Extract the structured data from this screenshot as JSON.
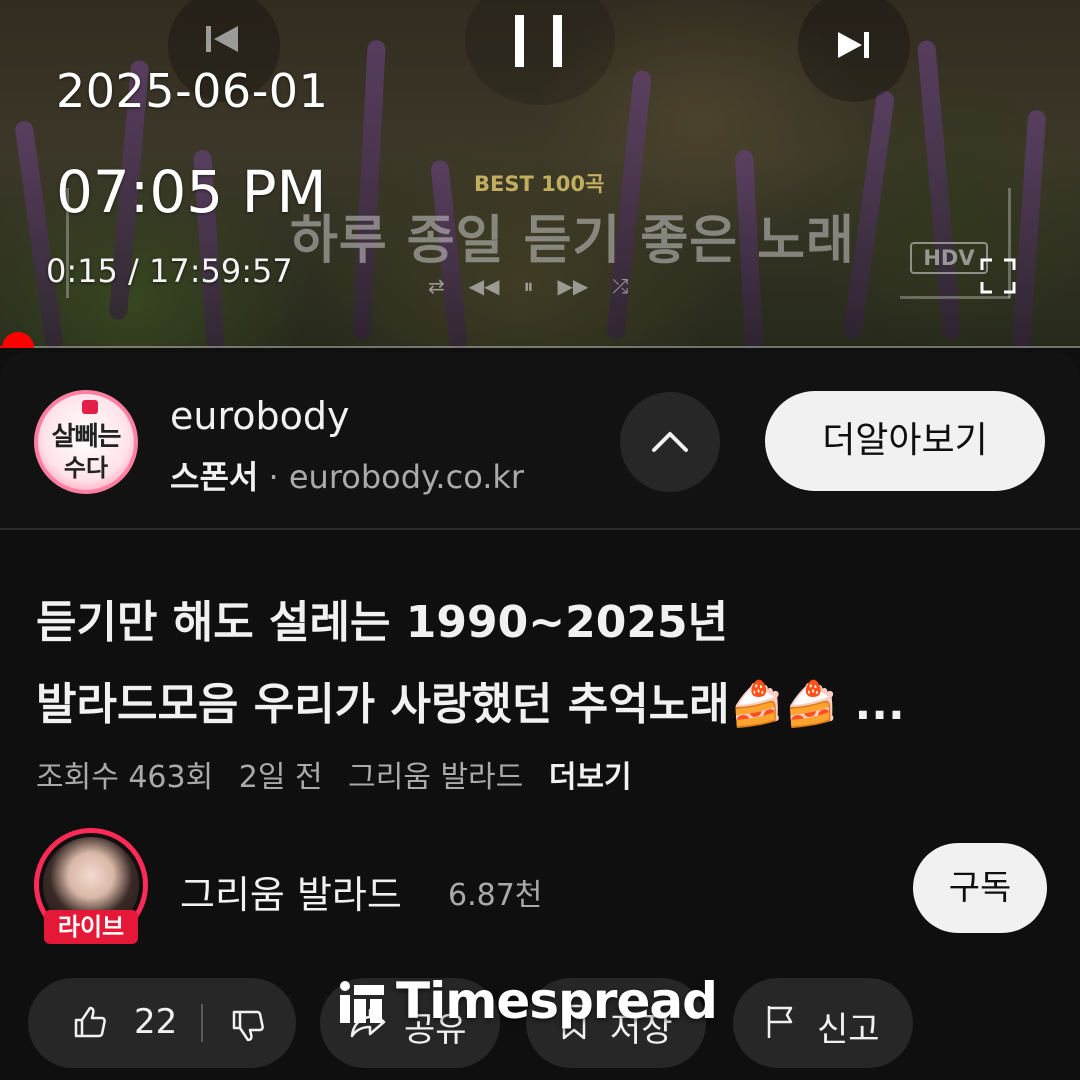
{
  "overlay": {
    "date": "2025-06-01",
    "clock": "07:05 PM"
  },
  "player": {
    "current_time": "0:15",
    "separator": " / ",
    "duration": "17:59:57",
    "progress_fraction": 0.0002,
    "thumbnail_text": {
      "badge": "BEST 100곡",
      "title": "하루 종일 듣기 좋은 노래",
      "quality": "HDV"
    }
  },
  "ad": {
    "advertiser": "eurobody",
    "logo_line1": "살빼는",
    "logo_line2": "수다",
    "sponsor_label": "스폰서",
    "dot": "·",
    "domain": "eurobody.co.kr",
    "cta_label": "더알아보기"
  },
  "video": {
    "title_line1": "듣기만 해도 설레는 1990~2025년",
    "title_line2": "발라드모음 우리가 사랑했던 추억노래🍰🍰 ...",
    "views": "조회수 463회",
    "age": "2일 전",
    "channel_tag": "그리움 발라드",
    "more_label": "더보기"
  },
  "channel": {
    "name": "그리움 발라드",
    "subscribers": "6.87천",
    "live_badge": "라이브",
    "subscribe_label": "구독"
  },
  "actions": {
    "like_count": "22",
    "share_label": "공유",
    "save_label": "저장",
    "report_label": "신고"
  },
  "watermark": {
    "text": "Timespread"
  },
  "colors": {
    "accent": "#ff0000",
    "background": "#0f0f0f",
    "live": "#e51937"
  }
}
